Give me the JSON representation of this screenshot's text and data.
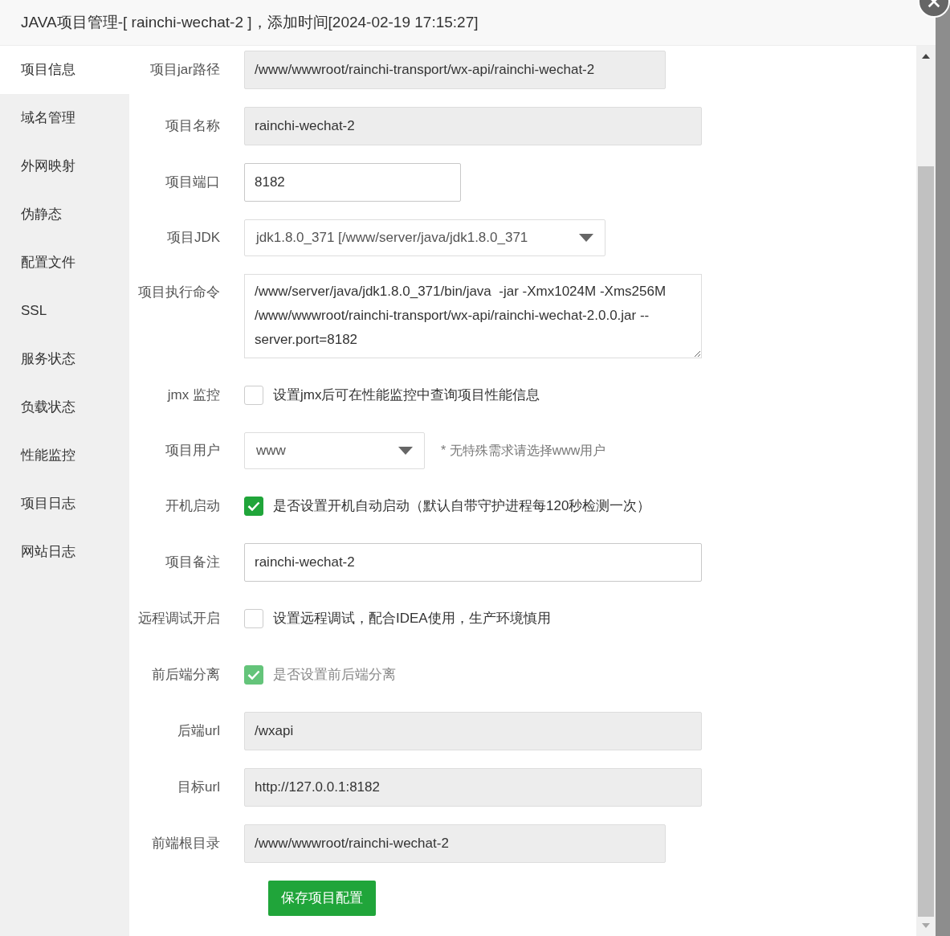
{
  "window": {
    "title": "JAVA项目管理-[ rainchi-wechat-2 ]，添加时间[2024-02-19 17:15:27]"
  },
  "sidebar": {
    "items": [
      {
        "label": "项目信息",
        "selected": true
      },
      {
        "label": "域名管理",
        "selected": false
      },
      {
        "label": "外网映射",
        "selected": false
      },
      {
        "label": "伪静态",
        "selected": false
      },
      {
        "label": "配置文件",
        "selected": false
      },
      {
        "label": "SSL",
        "selected": false
      },
      {
        "label": "服务状态",
        "selected": false
      },
      {
        "label": "负载状态",
        "selected": false
      },
      {
        "label": "性能监控",
        "selected": false
      },
      {
        "label": "项目日志",
        "selected": false
      },
      {
        "label": "网站日志",
        "selected": false
      }
    ]
  },
  "form": {
    "fields": [
      {
        "kind": "readonly_input",
        "label": "项目jar路径",
        "value": "/www/wwwroot/rainchi-transport/wx-api/rainchi-wechat-2"
      },
      {
        "kind": "readonly_input",
        "label": "项目名称",
        "value": "rainchi-wechat-2"
      },
      {
        "kind": "input",
        "label": "项目端口",
        "value": "8182"
      },
      {
        "kind": "select",
        "label": "项目JDK",
        "value": "jdk1.8.0_371 [/www/server/java/jdk1.8.0_371"
      },
      {
        "kind": "textarea",
        "label": "项目执行命令",
        "value": "/www/server/java/jdk1.8.0_371/bin/java  -jar -Xmx1024M -Xms256M  /www/wwwroot/rainchi-transport/wx-api/rainchi-wechat-2.0.0.jar --server.port=8182"
      },
      {
        "kind": "checkbox",
        "label": "jmx 监控",
        "text": "设置jmx后可在性能监控中查询项目性能信息",
        "checked": false,
        "disabled": false
      },
      {
        "kind": "select",
        "label": "项目用户",
        "value": "www",
        "hint": "* 无特殊需求请选择www用户"
      },
      {
        "kind": "checkbox",
        "label": "开机启动",
        "text": "是否设置开机自动启动（默认自带守护进程每120秒检测一次）",
        "checked": true,
        "disabled": false
      },
      {
        "kind": "input",
        "label": "项目备注",
        "value": "rainchi-wechat-2"
      },
      {
        "kind": "checkbox",
        "label": "远程调试开启",
        "text": "设置远程调试，配合IDEA使用，生产环境慎用",
        "checked": false,
        "disabled": false
      },
      {
        "kind": "checkbox",
        "label": "前后端分离",
        "text": "是否设置前后端分离",
        "checked": true,
        "disabled": true
      },
      {
        "kind": "readonly_input",
        "label": "后端url",
        "value": "/wxapi"
      },
      {
        "kind": "readonly_input",
        "label": "目标url",
        "value": "http://127.0.0.1:8182"
      },
      {
        "kind": "readonly_input",
        "label": "前端根目录",
        "value": "/www/wwwroot/rainchi-wechat-2"
      }
    ],
    "save_button": "保存项目配置"
  }
}
